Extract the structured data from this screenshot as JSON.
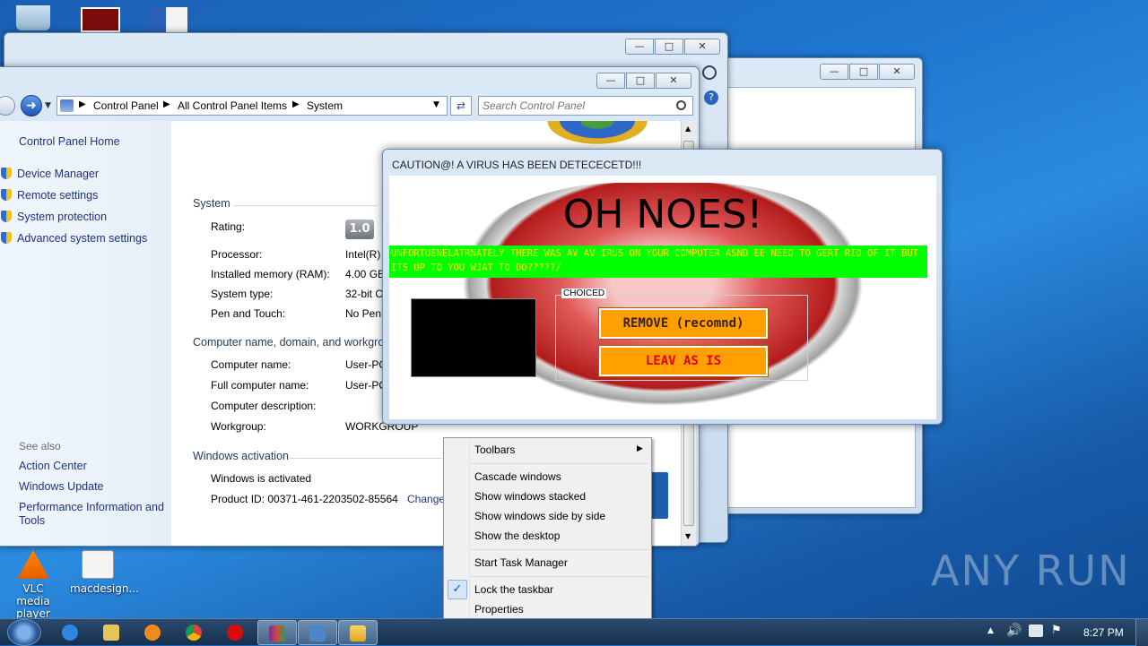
{
  "desktop": {
    "icons": [
      {
        "label": "VLC media player"
      },
      {
        "label": "macdesign..."
      }
    ],
    "watermark": "ANY RUN"
  },
  "control_panel": {
    "breadcrumb": [
      "Control Panel",
      "All Control Panel Items",
      "System"
    ],
    "search_placeholder": "Search Control Panel",
    "left_links": [
      "Control Panel Home",
      "Device Manager",
      "Remote settings",
      "System protection",
      "Advanced system settings"
    ],
    "see_also_label": "See also",
    "see_also_links": [
      "Action Center",
      "Windows Update",
      "Performance Information and Tools"
    ],
    "system_section": "System",
    "rating_label": "Rating:",
    "rating_value": "1.0",
    "processor_label": "Processor:",
    "processor_value": "Intel(R)",
    "memory_label": "Installed memory (RAM):",
    "memory_value": "4.00 GB",
    "systype_label": "System type:",
    "systype_value": "32-bit O",
    "pen_label": "Pen and Touch:",
    "pen_value": "No Pen",
    "computer_section": "Computer name, domain, and workgroup settings",
    "compname_label": "Computer name:",
    "compname_value": "User-PC",
    "fullname_label": "Full computer name:",
    "fullname_value": "User-PC",
    "desc_label": "Computer description:",
    "workgroup_label": "Workgroup:",
    "workgroup_value": "WORKGROUP",
    "activation_section": "Windows activation",
    "activated_text": "Windows is activated",
    "product_id": "Product ID: 00371-461-2203502-85564",
    "change_link": "Change"
  },
  "virus_dialog": {
    "title": "CAUTION@! A VIRUS HAS BEEN DETECECETD!!!",
    "headline": "OH NOES!",
    "message": "UNFORTUENELATRNATELY THERE WAS AV AV IRUS ON YOUR COMPUTER ASND EE NEED TO GERT RID OF IT BUT ITS UP TO YOU WJAT TO DO?????/",
    "group_label": "CHOICED",
    "remove_button": "REMOVE (recomnd)",
    "leave_button": "LEAV AS IS"
  },
  "context_menu": {
    "toolbars": "Toolbars",
    "cascade": "Cascade windows",
    "stacked": "Show windows stacked",
    "side_by_side": "Show windows side by side",
    "show_desktop": "Show the desktop",
    "task_manager": "Start Task Manager",
    "lock_taskbar": "Lock the taskbar",
    "properties": "Properties"
  },
  "taskbar": {
    "clock": "8:27 PM"
  },
  "colors": {
    "banner": "#00ff00",
    "banner_text": "#ffe600",
    "button_orange": "#ff9f00",
    "link_blue": "#1e3287"
  }
}
